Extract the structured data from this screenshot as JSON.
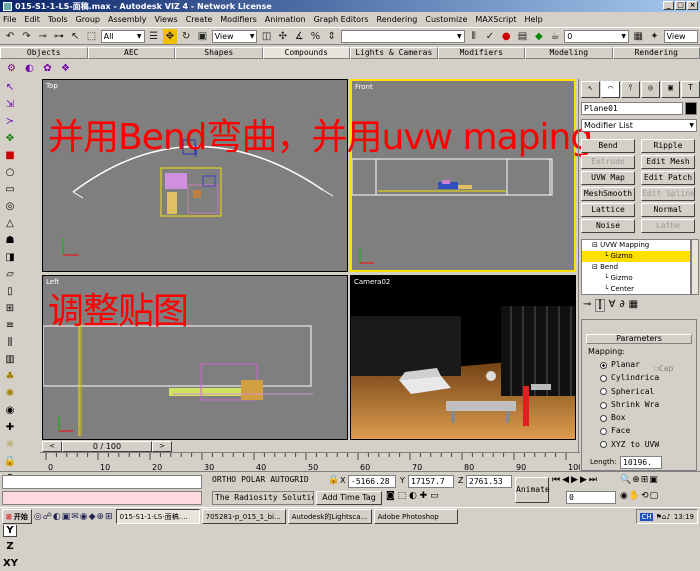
{
  "window": {
    "title": "015-S1-1-LS-面稿.max - Autodesk VIZ 4 - Network License"
  },
  "menu": [
    "File",
    "Edit",
    "Tools",
    "Group",
    "Assembly",
    "Views",
    "Create",
    "Modifiers",
    "Animation",
    "Graph Editors",
    "Rendering",
    "Customize",
    "MAXScript",
    "Help"
  ],
  "toolbar": {
    "selection_filter": "All",
    "ref_coord": "View",
    "named_selection": "",
    "view_right": "View",
    "zero_field": "0"
  },
  "tabs": [
    "Objects",
    "AEC",
    "Shapes",
    "Compounds",
    "Lights & Cameras",
    "Modifiers",
    "Modeling",
    "Rendering"
  ],
  "viewports": {
    "top": "Top",
    "front": "Front",
    "left": "Left",
    "camera": "Camera02"
  },
  "overlay": {
    "line1": "并用Bend弯曲，并用uvw maping",
    "line2": "调整贴图"
  },
  "command_panel": {
    "object_name": "Plane01",
    "modifier_list": "Modifier List",
    "buttons": [
      [
        "Bend",
        "Ripple"
      ],
      [
        "Extrude",
        "Edit Mesh"
      ],
      [
        "UVW Map",
        "Edit Patch"
      ],
      [
        "MeshSmooth",
        "Edit Spline"
      ],
      [
        "Lattice",
        "Normal"
      ],
      [
        "Noise",
        "Lathe"
      ]
    ],
    "disabled": [
      "Extrude",
      "Edit Spline",
      "Lathe"
    ],
    "stack": [
      {
        "label": "UVW Mapping",
        "indent": 0
      },
      {
        "label": "Gizmo",
        "indent": 1,
        "selected": true
      },
      {
        "label": "Bend",
        "indent": 0
      },
      {
        "label": "Gizmo",
        "indent": 1
      },
      {
        "label": "Center",
        "indent": 1
      }
    ],
    "rollout_title": "Parameters",
    "mapping_label": "Mapping:",
    "mapping_options": [
      "Planar",
      "Cylindrical",
      "Spherical",
      "Shrink Wrap",
      "Box",
      "Face",
      "XYZ to UVW"
    ],
    "mapping_selected": "Planar",
    "cap_label": "Cap",
    "length_label": "Length:",
    "length_value": "10196."
  },
  "time": {
    "slider": "0 / 100",
    "ruler_ticks": [
      "0",
      "10",
      "20",
      "30",
      "40",
      "50",
      "60",
      "70",
      "80",
      "90",
      "100"
    ]
  },
  "status": {
    "modes": [
      "ORTHO",
      "POLAR",
      "AUTOGRID"
    ],
    "x_label": "X",
    "x": "-5166.28",
    "y_label": "Y",
    "y": "17157.7",
    "z_label": "Z",
    "z": "2761.53",
    "radiosity": "The Radiosity Solution",
    "add_time_tag": "Add Time Tag",
    "animate": "Animate",
    "frame": "0"
  },
  "taskbar": {
    "start": "开始",
    "tasks": [
      "015-S1-1-LS-面稿....",
      "705281-p_015_1_bi...",
      "Autodesk的Lightsca...",
      "Adobe Photoshop"
    ],
    "clock": "13:19"
  },
  "colors": {
    "viewport_bg": "#7f7f7f",
    "camera_bg": "#000000",
    "active_border": "#ffe000",
    "overlay_text": "#ff0000",
    "title_start": "#0a246a",
    "title_end": "#a6caf0"
  }
}
